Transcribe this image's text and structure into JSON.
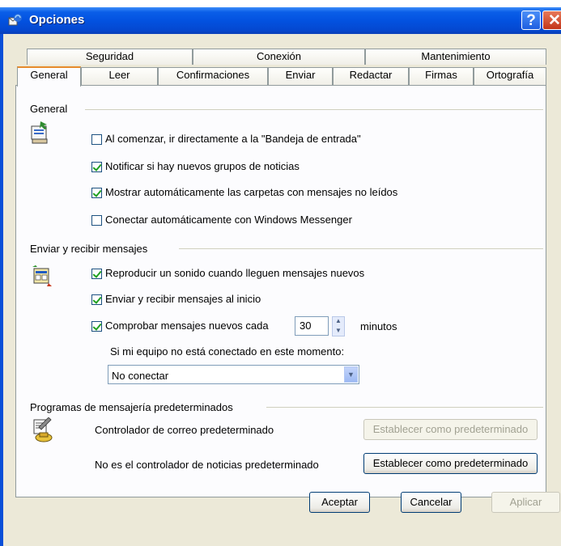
{
  "window": {
    "title": "Opciones"
  },
  "tabs_row1": [
    {
      "label": "Seguridad"
    },
    {
      "label": "Conexión"
    },
    {
      "label": "Mantenimiento"
    }
  ],
  "tabs_row2": [
    {
      "label": "General",
      "active": true
    },
    {
      "label": "Leer"
    },
    {
      "label": "Confirmaciones"
    },
    {
      "label": "Enviar"
    },
    {
      "label": "Redactar"
    },
    {
      "label": "Firmas"
    },
    {
      "label": "Ortografía"
    }
  ],
  "general": {
    "title": "General",
    "options": [
      {
        "label": "Al comenzar, ir directamente a la \"Bandeja de entrada\"",
        "checked": false
      },
      {
        "label": "Notificar si hay nuevos grupos de noticias",
        "checked": true
      },
      {
        "label": "Mostrar automáticamente las carpetas con mensajes no leídos",
        "checked": true
      },
      {
        "label": "Conectar automáticamente con Windows Messenger",
        "checked": false
      }
    ]
  },
  "send_receive": {
    "title": "Enviar y recibir mensajes",
    "options": [
      {
        "label": "Reproducir un sonido cuando lleguen mensajes nuevos",
        "checked": true
      },
      {
        "label": "Enviar y recibir mensajes al inicio",
        "checked": true
      },
      {
        "label": "Comprobar mensajes nuevos cada",
        "checked": true
      }
    ],
    "interval_value": "30",
    "interval_unit": "minutos",
    "offline_label": "Si mi equipo no está conectado en este momento:",
    "offline_selected": "No conectar"
  },
  "default_programs": {
    "title": "Programas de mensajería predeterminados",
    "mail_label": "Controlador de correo predeterminado",
    "mail_button": "Establecer como predeterminado",
    "news_label": "No es el controlador de noticias predeterminado",
    "news_button": "Establecer como predeterminado"
  },
  "footer": {
    "ok": "Aceptar",
    "cancel": "Cancelar",
    "apply": "Aplicar"
  },
  "colors": {
    "titlebar": "#0352e0",
    "active_tab_accent": "#e68b2c",
    "check": "#21a121"
  }
}
